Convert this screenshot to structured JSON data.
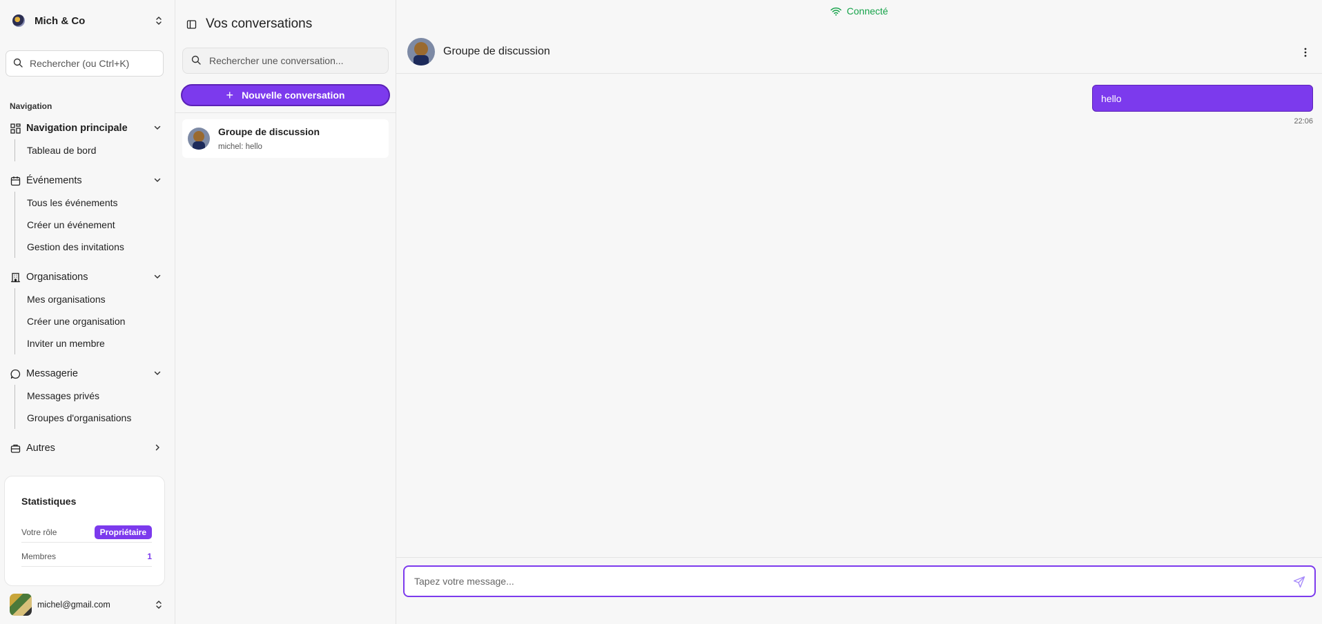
{
  "sidebar": {
    "org_name": "Mich & Co",
    "search_placeholder": "Rechercher (ou Ctrl+K)",
    "nav_caption": "Navigation",
    "groups": [
      {
        "label": "Navigation principale",
        "icon": "dashboard-grid-icon",
        "items": [
          "Tableau de bord"
        ]
      },
      {
        "label": "Événements",
        "icon": "calendar-icon",
        "items": [
          "Tous les événements",
          "Créer un événement",
          "Gestion des invitations"
        ]
      },
      {
        "label": "Organisations",
        "icon": "building-icon",
        "items": [
          "Mes organisations",
          "Créer une organisation",
          "Inviter un membre"
        ]
      },
      {
        "label": "Messagerie",
        "icon": "chat-bubble-icon",
        "items": [
          "Messages privés",
          "Groupes d'organisations"
        ]
      },
      {
        "label": "Autres",
        "icon": "briefcase-icon",
        "items": []
      }
    ],
    "stats": {
      "title": "Statistiques",
      "role_label": "Votre rôle",
      "role_value": "Propriétaire",
      "members_label": "Membres",
      "members_value": "1"
    },
    "user_email": "michel@gmail.com"
  },
  "conversations": {
    "title": "Vos conversations",
    "search_placeholder": "Rechercher une conversation...",
    "new_button": "Nouvelle conversation",
    "items": [
      {
        "name": "Groupe de discussion",
        "last_message": "michel: hello"
      }
    ]
  },
  "chat": {
    "status": "Connecté",
    "status_color": "#16a34a",
    "title": "Groupe de discussion",
    "messages": [
      {
        "text": "hello",
        "time": "22:06",
        "own": true
      }
    ],
    "composer_placeholder": "Tapez votre message..."
  },
  "colors": {
    "accent": "#7c3aed",
    "accent_dark": "#5b21b6"
  }
}
